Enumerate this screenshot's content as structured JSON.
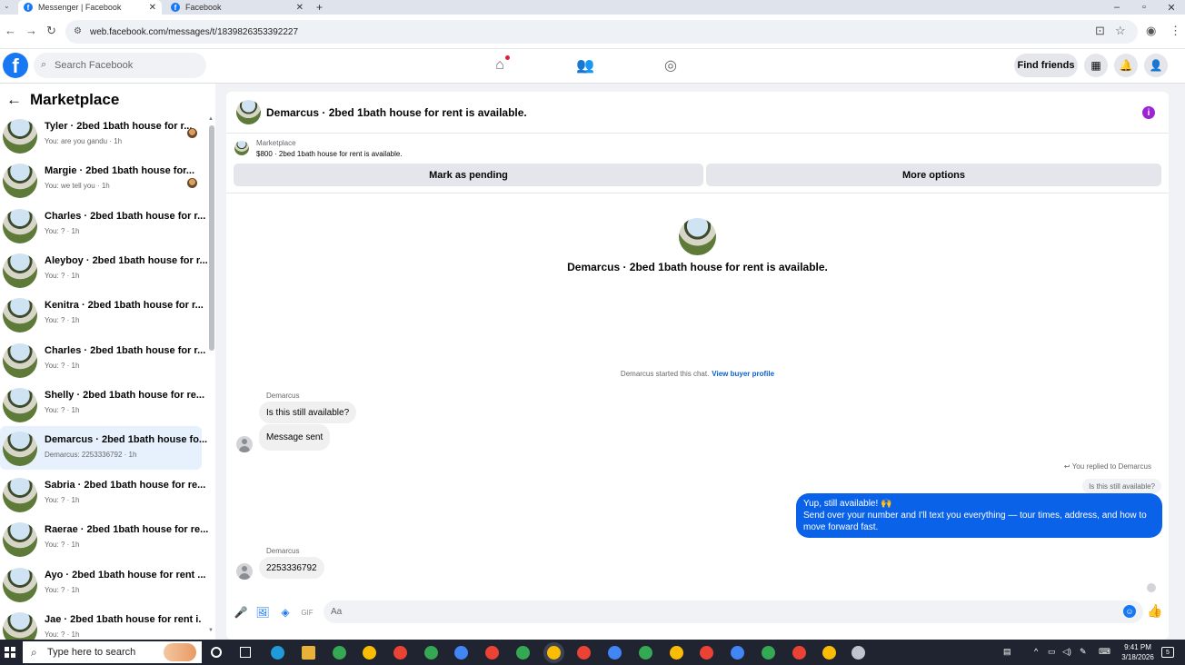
{
  "browser": {
    "tabs": [
      {
        "title": "Messenger | Facebook",
        "icon": "facebook-icon",
        "active": true
      },
      {
        "title": "Facebook",
        "icon": "facebook-icon",
        "active": false
      }
    ],
    "url": "web.facebook.com/messages/t/1839826353392227"
  },
  "fb": {
    "search_placeholder": "Search Facebook",
    "find_friends": "Find friends",
    "nav_icons": [
      "home-icon",
      "friends-icon",
      "groups-icon"
    ],
    "accent": "#1877f2"
  },
  "sidebar": {
    "title": "Marketplace",
    "conversations": [
      {
        "title": "Tyler · 2bed 1bath house for r...",
        "sub": "You: are you gandu · 1h",
        "read_avatar": true
      },
      {
        "title": "Margie · 2bed 1bath house for...",
        "sub": "You: we tell you · 1h",
        "read_avatar": true
      },
      {
        "title": "Charles · 2bed 1bath house for r...",
        "sub": "You: ? · 1h"
      },
      {
        "title": "Aleyboy · 2bed 1bath house for r...",
        "sub": "You: ? · 1h"
      },
      {
        "title": "Kenitra · 2bed 1bath house for r...",
        "sub": "You: ? · 1h"
      },
      {
        "title": "Charles · 2bed 1bath house for r...",
        "sub": "You: ? · 1h"
      },
      {
        "title": "Shelly · 2bed 1bath house for re...",
        "sub": "You: ? · 1h"
      },
      {
        "title": "Demarcus · 2bed 1bath house fo...",
        "sub": "Demarcus: 2253336792 · 1h",
        "selected": true
      },
      {
        "title": "Sabria · 2bed 1bath house for re...",
        "sub": "You: ? · 1h"
      },
      {
        "title": "Raerae · 2bed 1bath house for re...",
        "sub": "You: ? · 1h"
      },
      {
        "title": "Ayo · 2bed 1bath house for rent ...",
        "sub": "You: ? · 1h"
      },
      {
        "title": "Jae · 2bed 1bath house for rent i...",
        "sub": "You: ? · 1h"
      }
    ]
  },
  "chat": {
    "header_title": "Demarcus · 2bed 1bath house for rent is available.",
    "listing": {
      "category": "Marketplace",
      "price_line": "$800 · 2bed 1bath house for rent is available."
    },
    "mark_pending": "Mark as pending",
    "more_options": "More options",
    "intro_title": "Demarcus · 2bed 1bath house for rent is available.",
    "started_text": "Demarcus started this chat.",
    "view_buyer": "View buyer profile",
    "sender_name": "Demarcus",
    "msg1": "Is this still available?",
    "msg2": "Message sent",
    "replied_to": "You replied to Demarcus",
    "quoted": "Is this still available?",
    "reply_line1": "Yup, still available! 🙌",
    "reply_line2": "Send over your number and I'll text you everything — tour times, address, and how to move forward fast.",
    "msg3": "2253336792",
    "composer_placeholder": "Aa"
  },
  "taskbar": {
    "search_placeholder": "Type here to search",
    "time": "9:41 PM",
    "date": "3/18/2026",
    "notif_count": "5"
  }
}
